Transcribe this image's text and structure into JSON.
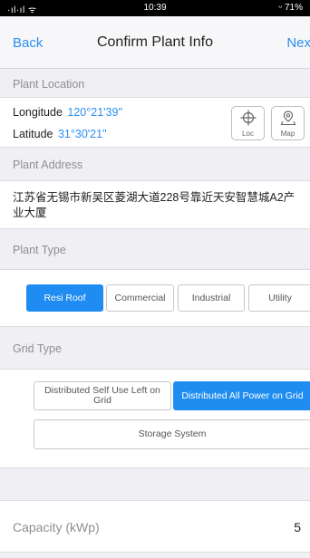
{
  "status_bar": {
    "signal": "·ıl·ıl ᯤ",
    "time": "10:39",
    "battery": "ᵕ 71%"
  },
  "nav": {
    "back": "Back",
    "title": "Confirm Plant Info",
    "next": "Nex"
  },
  "plant_location": {
    "header": "Plant Location",
    "longitude_label": "Longitude",
    "longitude_value": "120°21'39\"",
    "latitude_label": "Latitude",
    "latitude_value": "31°30'21\"",
    "loc_button": "Loc",
    "map_button": "Map"
  },
  "plant_address": {
    "header": "Plant Address",
    "value": "江苏省无锡市新吴区菱湖大道228号靠近天安智慧城A2产业大厦"
  },
  "plant_type": {
    "header": "Plant Type",
    "options": [
      "Resi Roof",
      "Commercial",
      "Industrial",
      "Utility"
    ],
    "selected": "Resi Roof"
  },
  "grid_type": {
    "header": "Grid Type",
    "options": [
      "Distributed Self Use Left on Grid",
      "Distributed All Power on Grid",
      "Storage System"
    ],
    "selected": "Distributed All Power on Grid"
  },
  "capacity": {
    "label": "Capacity (kWp)",
    "value": "5"
  },
  "colors": {
    "accent": "#1e8cf0",
    "link": "#2b8ef0",
    "background": "#efeff4"
  }
}
